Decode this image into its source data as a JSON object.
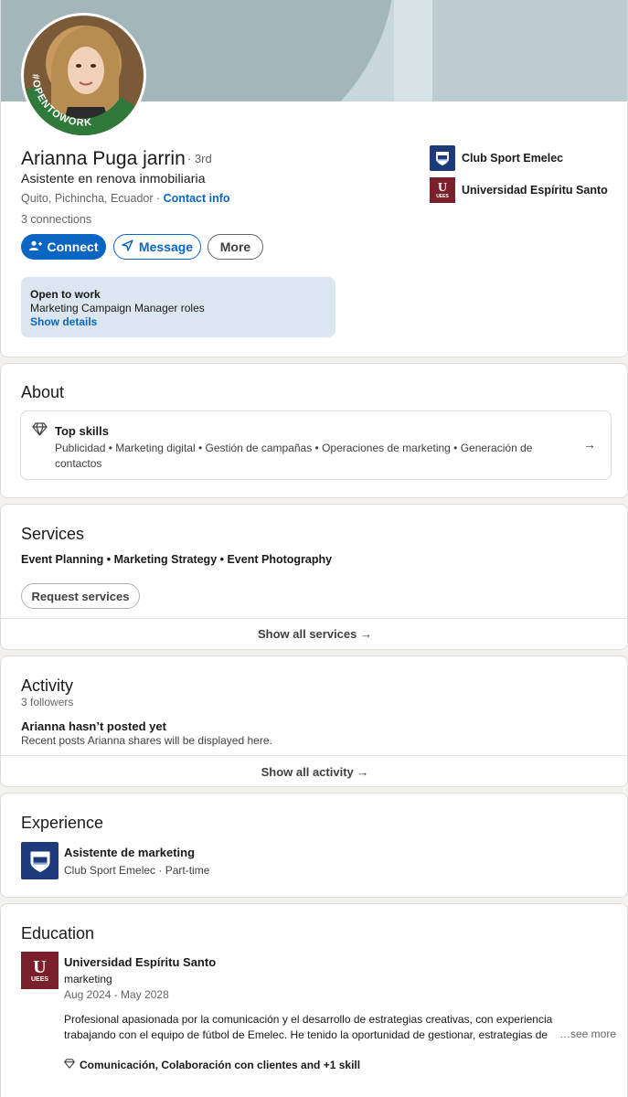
{
  "profile": {
    "name": "Arianna Puga jarrin",
    "degree": "· 3rd",
    "headline": "Asistente en renova inmobiliaria",
    "location": "Quito, Pichincha, Ecuador · ",
    "contact_info": "Contact info",
    "connections": "3 connections",
    "avatar_badge": "#OPENTOWORK"
  },
  "actions": {
    "connect": "Connect",
    "message": "Message",
    "more": "More"
  },
  "open_to_work": {
    "title": "Open to work",
    "roles": "Marketing Campaign Manager roles",
    "link": "Show details"
  },
  "orgs": [
    {
      "name": "Club Sport Emelec",
      "icon": "emelec-logo"
    },
    {
      "name": "Universidad Espíritu Santo",
      "icon": "uees-logo"
    }
  ],
  "about": {
    "title": "About",
    "top_skills_title": "Top skills",
    "top_skills": "Publicidad • Marketing digital • Gestión de campañas • Operaciones de marketing • Generación de contactos"
  },
  "services": {
    "title": "Services",
    "list": "Event Planning • Marketing Strategy • Event Photography",
    "request_button": "Request services",
    "show_all": "Show all services →"
  },
  "activity": {
    "title": "Activity",
    "followers": "3 followers",
    "no_posts_title": "Arianna hasn’t posted yet",
    "no_posts_sub": "Recent posts Arianna shares will be displayed here.",
    "show_all": "Show all activity →"
  },
  "experience": {
    "title": "Experience",
    "items": [
      {
        "title": "Asistente de marketing",
        "subtitle": "Club Sport Emelec · Part-time"
      }
    ]
  },
  "education": {
    "title": "Education",
    "items": [
      {
        "school": "Universidad Espíritu Santo",
        "field": "marketing",
        "dates": "Aug 2024 - May 2028",
        "description": "Profesional apasionada por la comunicación y el desarrollo de estrategias creativas, con experiencia trabajando con el equipo de fútbol de Emelec. He tenido la oportunidad de gestionar, estrategias de redes sociales",
        "see_more": "…see more",
        "skills": "Comunicación, Colaboración con clientes and +1 skill"
      }
    ]
  },
  "colors": {
    "primary": "#0a66c2",
    "open_to_work_green": "#2f7a3a",
    "emelec_blue": "#1d3a7a",
    "uees_maroon": "#7a1f2c"
  }
}
